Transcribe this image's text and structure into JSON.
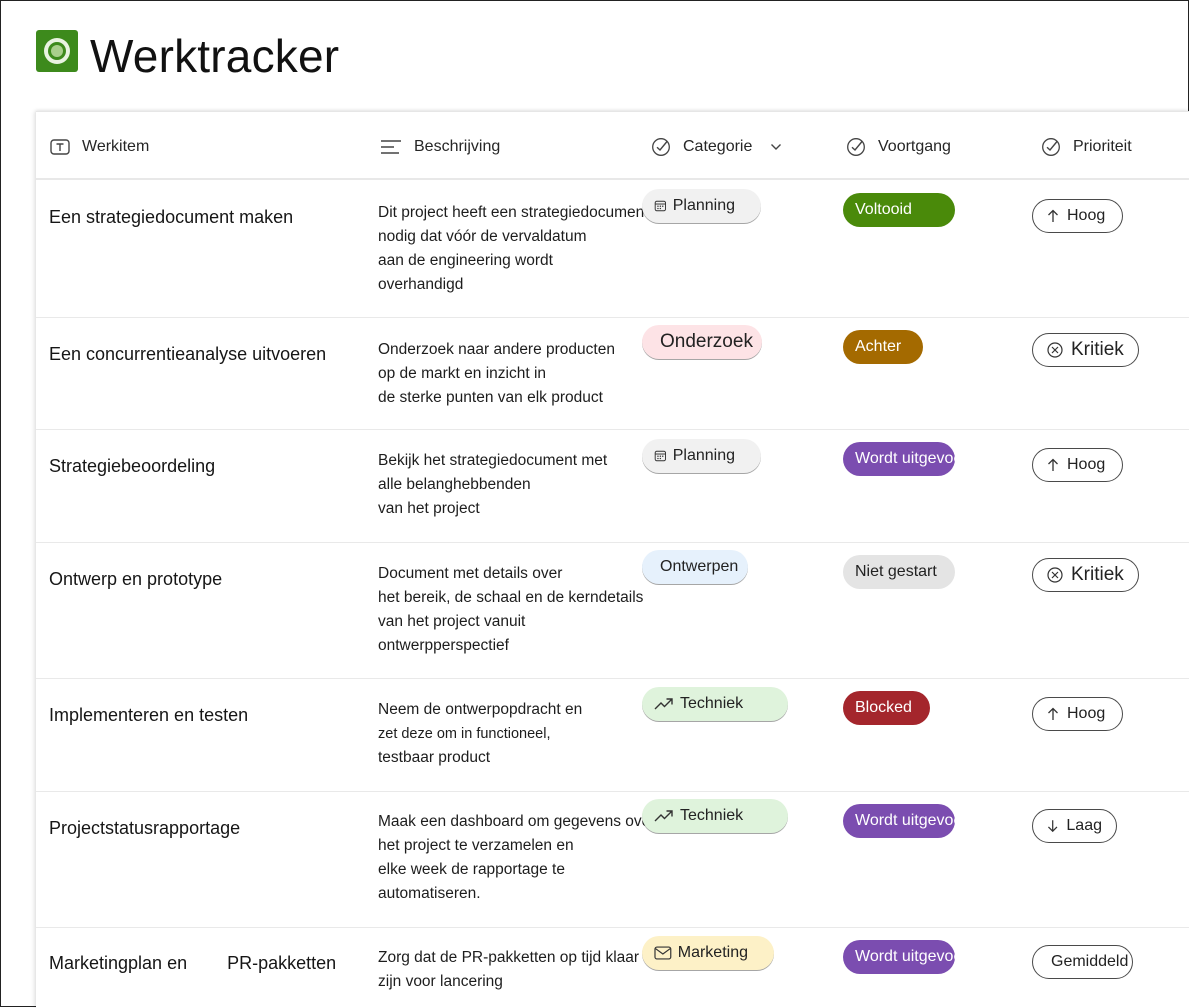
{
  "app": {
    "title": "Werktracker",
    "icon": "app-logo-icon"
  },
  "columns": [
    {
      "label": "Werkitem",
      "icon": "text-field-icon"
    },
    {
      "label": "Beschrijving",
      "icon": "lines-icon"
    },
    {
      "label": "Categorie",
      "icon": "check-circle-icon",
      "sort": "chevron-down-icon"
    },
    {
      "label": "Voortgang",
      "icon": "check-circle-icon"
    },
    {
      "label": "Prioriteit",
      "icon": "check-circle-icon"
    }
  ],
  "rows": [
    {
      "title": "Een strategiedocument maken",
      "desc": [
        "Dit project heeft een strategiedocument",
        "nodig dat vóór de vervaldatum",
        "aan de engineering wordt",
        "overhandigd"
      ],
      "category": {
        "label": "Planning",
        "icon": "calendar-icon",
        "bg": "#f1f1f1"
      },
      "progress": {
        "label": "Voltooid",
        "color": "#4a8a0a"
      },
      "priority": {
        "label": "Hoog",
        "icon": "arrow-up-icon"
      }
    },
    {
      "title": "Een concurrentieanalyse uitvoeren",
      "desc": [
        "Onderzoek naar andere producten",
        "op de markt en inzicht in",
        "de sterke punten van elk product"
      ],
      "category": {
        "label": "Onderzoek",
        "icon": "people-icon",
        "bg": "#fde3e6"
      },
      "progress": {
        "label": "Achter",
        "color": "#a46a00"
      },
      "priority": {
        "label": "Kritiek",
        "icon": "circle-x-icon"
      }
    },
    {
      "title": "Strategiebeoordeling",
      "desc": [
        "Bekijk het strategiedocument met",
        "alle belanghebbenden",
        "van het project"
      ],
      "category": {
        "label": "Planning",
        "icon": "calendar-icon",
        "bg": "#f1f1f1"
      },
      "progress": {
        "label": "Wordt uitgevoerd",
        "color": "#7b4db0"
      },
      "priority": {
        "label": "Hoog",
        "icon": "arrow-up-icon"
      }
    },
    {
      "title": "Ontwerp en prototype",
      "desc": [
        "Document met details over",
        "het bereik, de schaal en de kerndetails",
        "van het project vanuit",
        "ontwerpperspectief"
      ],
      "category": {
        "label": "Ontwerpen",
        "icon": "thumbs-up-icon",
        "bg": "#e6f1fc"
      },
      "progress": {
        "label": "Niet gestart",
        "color": "#e4e4e4"
      },
      "priority": {
        "label": "Kritiek",
        "icon": "circle-x-icon"
      }
    },
    {
      "title": "Implementeren en testen",
      "desc": [
        "Neem de ontwerpopdracht en",
        "zet deze om in functioneel,",
        "testbaar product"
      ],
      "category": {
        "label": "Techniek",
        "icon": "trend-up-icon",
        "bg": "#dff3dc"
      },
      "progress": {
        "label": "Blocked",
        "color": "#a4262c"
      },
      "priority": {
        "label": "Hoog",
        "icon": "arrow-up-icon"
      }
    },
    {
      "title": "Projectstatusrapportage",
      "desc": [
        "Maak een dashboard om gegevens over",
        "het project te verzamelen en",
        "elke week de rapportage te",
        "automatiseren."
      ],
      "category": {
        "label": "Techniek",
        "icon": "trend-up-icon",
        "bg": "#dff3dc"
      },
      "progress": {
        "label": "Wordt uitgevoerd",
        "color": "#7b4db0"
      },
      "priority": {
        "label": "Laag",
        "icon": "arrow-down-icon"
      }
    },
    {
      "title": "Marketingplan en        PR-pakketten",
      "desc": [
        "Zorg dat de PR-pakketten op tijd klaar",
        "zijn voor lancering"
      ],
      "category": {
        "label": "Marketing",
        "icon": "mail-icon",
        "bg": "#fdf1c7"
      },
      "progress": {
        "label": "Wordt uitgevoerd",
        "color": "#7b4db0"
      },
      "priority": {
        "label": "Gemiddeld",
        "icon": ""
      }
    }
  ]
}
